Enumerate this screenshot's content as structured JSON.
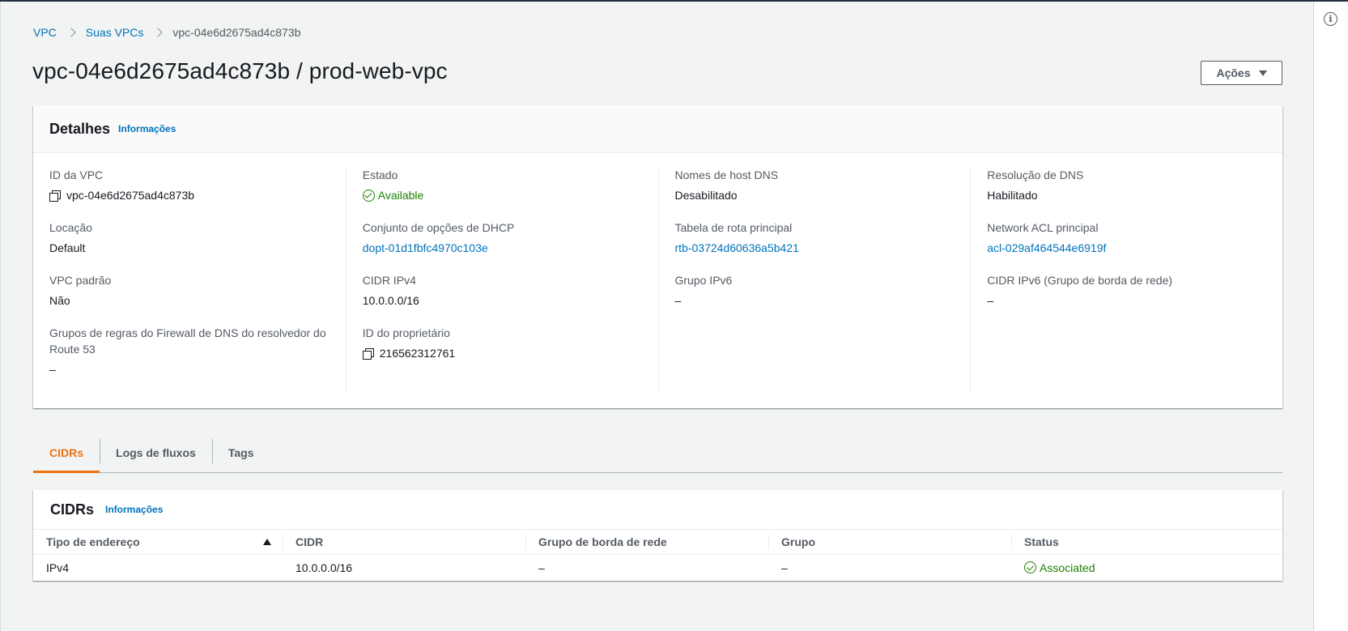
{
  "breadcrumb": {
    "items": [
      "VPC",
      "Suas VPCs"
    ],
    "current": "vpc-04e6d2675ad4c873b"
  },
  "page": {
    "title": "vpc-04e6d2675ad4c873b / prod-web-vpc",
    "actions_label": "Ações"
  },
  "details": {
    "title": "Detalhes",
    "info_label": "Informações",
    "columns": [
      [
        {
          "label": "ID da VPC",
          "value": "vpc-04e6d2675ad4c873b"
        },
        {
          "label": "Locação",
          "value": "Default"
        },
        {
          "label": "VPC padrão",
          "value": "Não"
        },
        {
          "label": "Grupos de regras do Firewall de DNS do resolvedor do Route 53",
          "value": "–"
        }
      ],
      [
        {
          "label": "Estado",
          "value": "Available"
        },
        {
          "label": "Conjunto de opções de DHCP",
          "value": "dopt-01d1fbfc4970c103e"
        },
        {
          "label": "CIDR IPv4",
          "value": "10.0.0.0/16"
        },
        {
          "label": "ID do proprietário",
          "value": "216562312761"
        }
      ],
      [
        {
          "label": "Nomes de host DNS",
          "value": "Desabilitado"
        },
        {
          "label": "Tabela de rota principal",
          "value": "rtb-03724d60636a5b421"
        },
        {
          "label": "Grupo IPv6",
          "value": "–"
        }
      ],
      [
        {
          "label": "Resolução de DNS",
          "value": "Habilitado"
        },
        {
          "label": "Network ACL principal",
          "value": "acl-029af464544e6919f"
        },
        {
          "label": "CIDR IPv6 (Grupo de borda de rede)",
          "value": "–"
        }
      ]
    ]
  },
  "tabs": [
    {
      "label": "CIDRs"
    },
    {
      "label": "Logs de fluxos"
    },
    {
      "label": "Tags"
    }
  ],
  "cidrs": {
    "title": "CIDRs",
    "info_label": "Informações",
    "headers": [
      "Tipo de endereço",
      "CIDR",
      "Grupo de borda de rede",
      "Grupo",
      "Status"
    ],
    "rows": [
      [
        "IPv4",
        "10.0.0.0/16",
        "–",
        "–",
        "Associated"
      ]
    ]
  },
  "colors": {
    "link": "#0073bb",
    "success": "#1d8102",
    "active_tab": "#ec7211"
  },
  "icons": {
    "breadcrumb_separator": "chevron-right-icon",
    "copy": "copy-icon",
    "status_ok": "check-circle-icon",
    "actions_caret": "caret-down-icon",
    "sort": "sort-ascending-icon",
    "info_panel": "info-icon"
  }
}
